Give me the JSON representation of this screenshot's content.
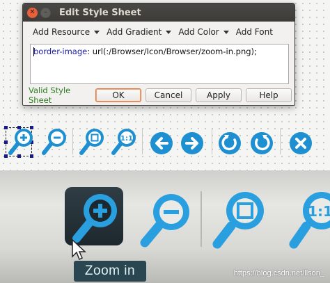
{
  "dialog": {
    "title": "Edit Style Sheet",
    "toolbar": [
      {
        "label": "Add Resource",
        "has_menu": true
      },
      {
        "label": "Add Gradient",
        "has_menu": true
      },
      {
        "label": "Add Color",
        "has_menu": true
      },
      {
        "label": "Add Font",
        "has_menu": false
      }
    ],
    "editor": {
      "property": "border-image",
      "value": ": url(:/Browser/Icon/Browser/zoom-in.png);"
    },
    "status": "Valid Style Sheet",
    "buttons": {
      "ok": "OK",
      "cancel": "Cancel",
      "apply": "Apply",
      "help": "Help"
    }
  },
  "icon_toolbar": {
    "icons": [
      "zoom-in-icon",
      "zoom-out-icon",
      "zoom-fit-icon",
      "zoom-actual-icon",
      "back-icon",
      "forward-icon",
      "rotate-left-icon",
      "rotate-right-icon",
      "close-icon"
    ],
    "colors": {
      "accent": "#1e8fd0",
      "accent_dark": "#1565a8"
    }
  },
  "photo": {
    "tooltip": "Zoom in",
    "watermark": "https://blog.csdn.net/llson_"
  }
}
